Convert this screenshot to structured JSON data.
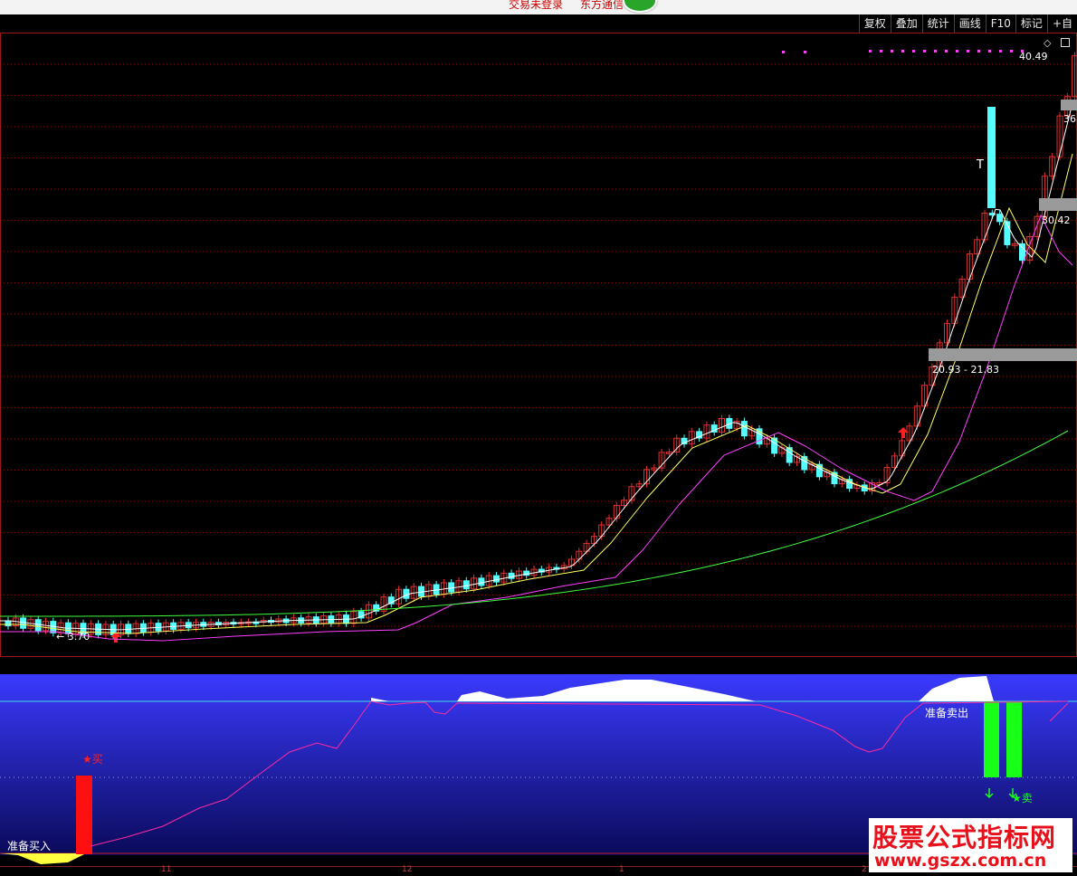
{
  "top_strip": {
    "left_text": "交易未登录",
    "right_text": "东方通信"
  },
  "toolbar": {
    "buttons": [
      "复权",
      "叠加",
      "统计",
      "画线",
      "F10",
      "标记",
      "+自"
    ]
  },
  "main_chart": {
    "price_labels": {
      "top_price": "40.49",
      "right_36": "36",
      "right_3042": "30.42",
      "range_label": "20.93 - 21.83",
      "low_label": "← 3.70",
      "t_mark": "T"
    },
    "icons": [
      "diamond-icon",
      "window-icon"
    ],
    "colors": {
      "up": "#e03030",
      "down": "#54ffff",
      "ma5": "#ffffff",
      "ma10": "#ffff60",
      "ma20": "#ff40ff",
      "ma60": "#40ff40",
      "gridline": "#8a1010"
    }
  },
  "sub_chart": {
    "labels": {
      "buy_prep": "准备买入",
      "buy": "★买",
      "sell_prep": "准备卖出",
      "sell": "★卖"
    },
    "colors": {
      "line": "#ff2aa0",
      "ref_line": "#40e0e0",
      "buy_bar": "#ff1010",
      "sell_bar": "#18ff18",
      "area_fill": "#ffffff",
      "prep_fill": "#ffff40"
    }
  },
  "axis": {
    "tick_labels": [
      "11",
      "12",
      "1",
      "2"
    ]
  },
  "watermark": {
    "title": "股票公式指标网",
    "url": "www.gszx.com.cn"
  }
}
